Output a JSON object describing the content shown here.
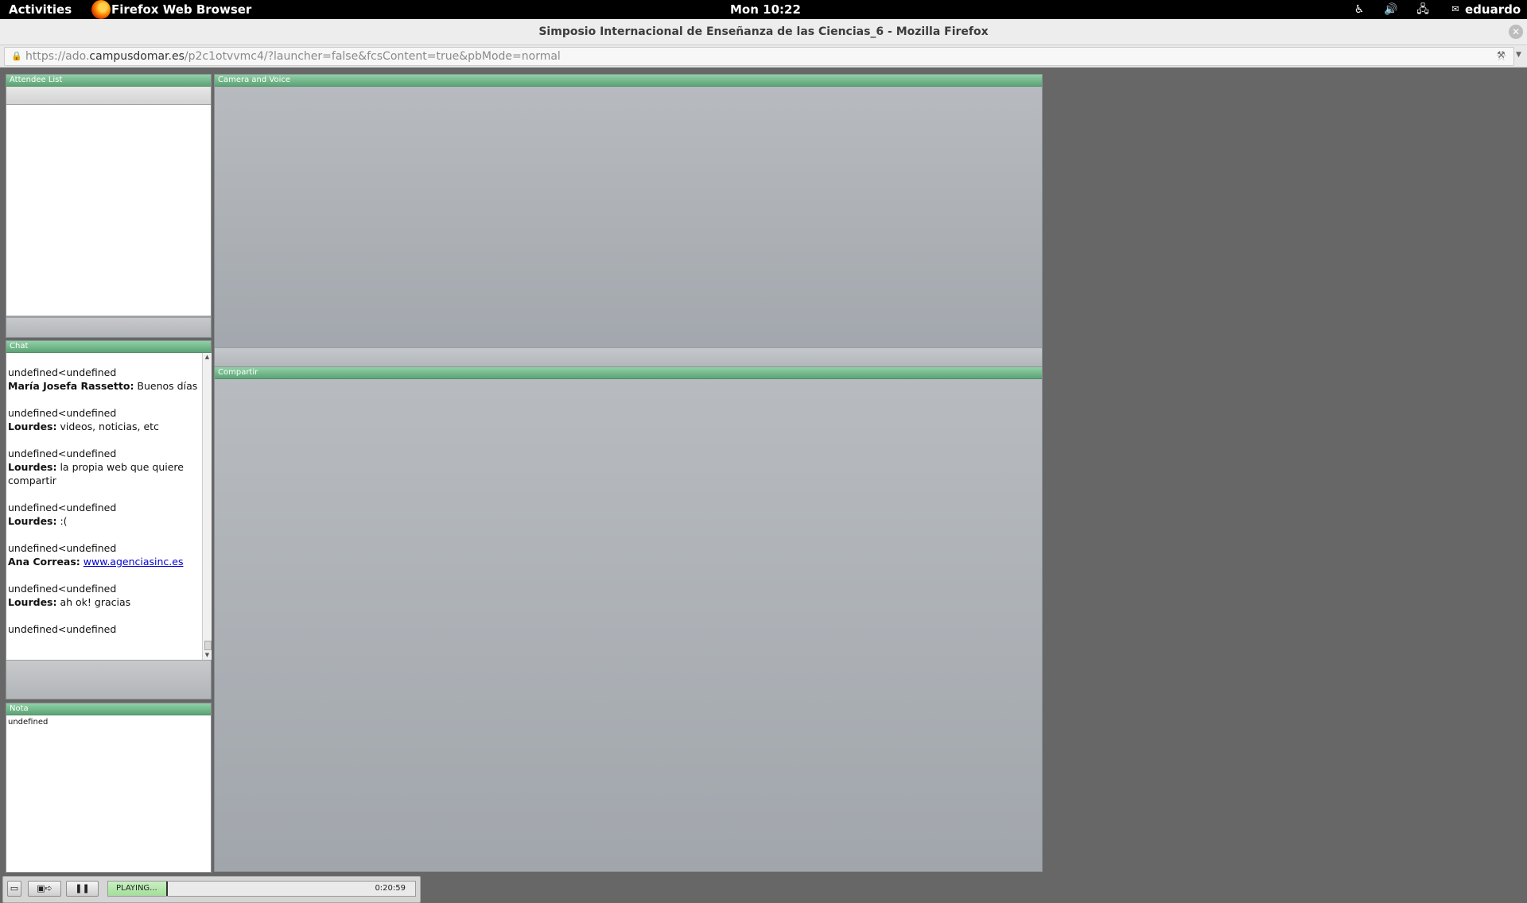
{
  "topbar": {
    "activities": "Activities",
    "app_name": "Firefox Web Browser",
    "clock": "Mon 10:22",
    "user": "eduardo",
    "icons": [
      "accessibility-icon",
      "volume-icon",
      "network-icon",
      "chat-status-icon"
    ]
  },
  "window": {
    "title": "Simposio Internacional de Enseñanza de las Ciencias_6 - Mozilla Firefox",
    "url_prefix": "https://ado.",
    "url_domain": "campusdomar.es",
    "url_path": "/p2c1otvvmc4/?launcher=false&fcsContent=true&pbMode=normal"
  },
  "panels": {
    "attendee_title": "Attendee List",
    "camera_title": "Camera and Voice",
    "chat_title": "Chat",
    "share_title": "Compartir",
    "nota_title": "Nota",
    "nota_text": "undefined"
  },
  "chat": {
    "messages": [
      {
        "header": "undefined<undefined",
        "author": "María Josefa Rassetto:",
        "text": " Buenos días"
      },
      {
        "header": "undefined<undefined",
        "author": "Lourdes:",
        "text": " videos, noticias, etc"
      },
      {
        "header": "undefined<undefined",
        "author": "Lourdes:",
        "text": " la propia web que quiere compartir"
      },
      {
        "header": "undefined<undefined",
        "author": "Lourdes:",
        "text": " :("
      },
      {
        "header": "undefined<undefined",
        "author": "Ana Correas:",
        "text": " ",
        "link": "www.agenciasinc.es"
      },
      {
        "header": "undefined<undefined",
        "author": "Lourdes:",
        "text": " ah ok! gracias"
      },
      {
        "header": "undefined<undefined",
        "author": "",
        "text": ""
      }
    ]
  },
  "playback": {
    "status": "PLAYING...",
    "time": "0:20:59",
    "progress_fraction": 0.19
  }
}
